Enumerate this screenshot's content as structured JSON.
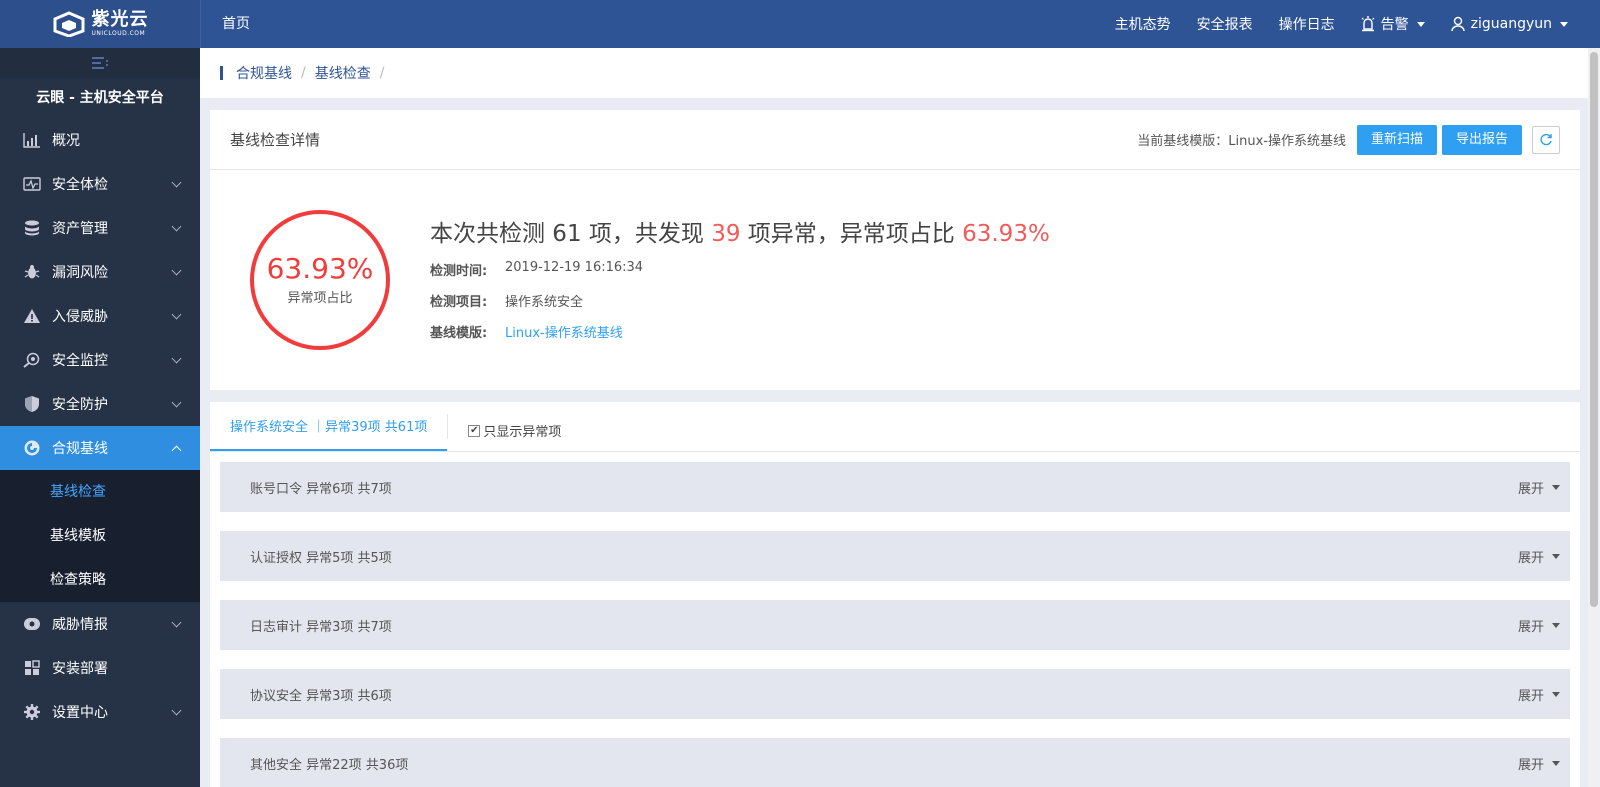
{
  "header": {
    "brand_cn": "紫光云",
    "brand_en": "UNICLOUD.COM",
    "home": "首页",
    "nav": [
      "主机态势",
      "安全报表",
      "操作日志"
    ],
    "alarm": "告警",
    "user": "ziguangyun"
  },
  "sidebar": {
    "platform_title": "云眼 - 主机安全平台",
    "items": [
      {
        "label": "概况",
        "icon": "chart-icon"
      },
      {
        "label": "安全体检",
        "icon": "checkup-icon"
      },
      {
        "label": "资产管理",
        "icon": "database-icon"
      },
      {
        "label": "漏洞风险",
        "icon": "bug-icon"
      },
      {
        "label": "入侵威胁",
        "icon": "warning-icon"
      },
      {
        "label": "安全监控",
        "icon": "monitor-icon"
      },
      {
        "label": "安全防护",
        "icon": "shield-icon"
      },
      {
        "label": "合规基线",
        "icon": "compliance-icon"
      }
    ],
    "subitems": [
      "基线检查",
      "基线模板",
      "检查策略"
    ],
    "items_after": [
      {
        "label": "威胁情报",
        "icon": "intel-icon"
      },
      {
        "label": "安装部署",
        "icon": "deploy-icon"
      },
      {
        "label": "设置中心",
        "icon": "gear-icon"
      }
    ]
  },
  "breadcrumb": [
    "合规基线",
    "基线检查"
  ],
  "detail": {
    "title": "基线检查详情",
    "template_label": "当前基线模版：Linux-操作系统基线",
    "rescan": "重新扫描",
    "export": "导出报告",
    "ring_value": "63.93%",
    "ring_label": "异常项占比",
    "headline_a": "本次共检测 61 项，共发现 ",
    "headline_count": "39",
    "headline_b": " 项异常，异常项占比 ",
    "headline_pct": "63.93%",
    "time_key": "检测时间:",
    "time_val": "2019-12-19 16:16:34",
    "item_key": "检测项目:",
    "item_val": "操作系统安全",
    "tpl_key": "基线模版:",
    "tpl_val": "Linux-操作系统基线"
  },
  "tabs": {
    "active": "操作系统安全 ｜异常39项  共61项",
    "only_abnormal": "只显示异常项",
    "only_abnormal_checked": true
  },
  "groups": [
    {
      "name": "账号口令 异常6项 共7项",
      "action": "展开"
    },
    {
      "name": "认证授权 异常5项 共5项",
      "action": "展开"
    },
    {
      "name": "日志审计 异常3项 共7项",
      "action": "展开"
    },
    {
      "name": "协议安全 异常3项 共6项",
      "action": "展开"
    },
    {
      "name": "其他安全 异常22项 共36项",
      "action": "展开"
    }
  ],
  "colors": {
    "topbar": "#2f5496",
    "sidebar": "#263245",
    "accent": "#2f9ff2",
    "danger": "#f23b3b"
  }
}
